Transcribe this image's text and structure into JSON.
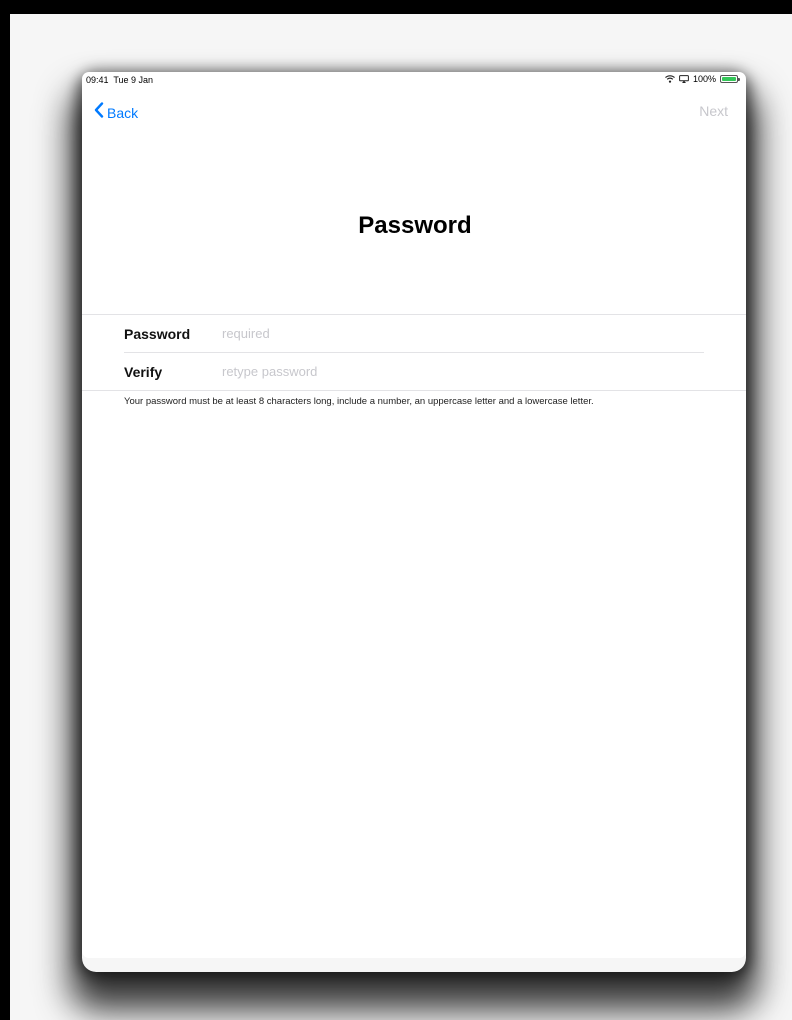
{
  "status_bar": {
    "time": "09:41",
    "date": "Tue 9 Jan",
    "battery_percent": "100%",
    "battery_level": 1.0,
    "wifi_icon": "wifi-icon",
    "screen_icon": "screen-mirroring-icon"
  },
  "nav": {
    "back_label": "Back",
    "next_label": "Next"
  },
  "page": {
    "title": "Password"
  },
  "form": {
    "password": {
      "label": "Password",
      "value": "",
      "placeholder": "required"
    },
    "verify": {
      "label": "Verify",
      "value": "",
      "placeholder": "retype password"
    }
  },
  "hint": "Your password must be at least 8 characters long, include a number, an uppercase letter and a lowercase letter.",
  "colors": {
    "accent": "#007aff",
    "disabled": "#c7c7cc",
    "battery_charge": "#34c759"
  }
}
